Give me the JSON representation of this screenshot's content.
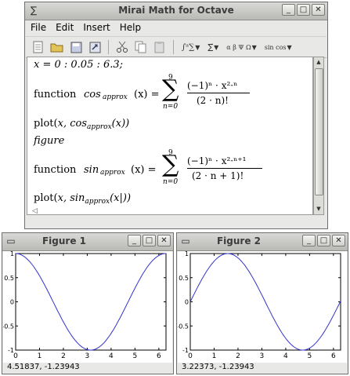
{
  "main_window": {
    "title": "Mirai Math for Octave",
    "icon": "sigma-icon",
    "menus": [
      "File",
      "Edit",
      "Insert",
      "Help"
    ],
    "menu_mnemonics": [
      "F",
      "E",
      "I",
      "H"
    ],
    "toolbar_icons": [
      "new-document-icon",
      "open-folder-icon",
      "save-icon",
      "export-icon",
      "cut-icon",
      "copy-icon",
      "paste-icon",
      "integral-sum-icon",
      "arrow-sum-icon",
      "greek-letters-icon",
      "functions-icon"
    ],
    "toolbar_math_labels": [
      "∫ᵃ∑",
      "∑⃗",
      "α β Ψ Ω",
      "sin cos"
    ],
    "lines": {
      "l1": "x = 0 : 0.05 : 6.3;",
      "l2_prefix": "function",
      "l2_fn": "cos",
      "l2_sub": "approx",
      "l2_arg": "(x) =",
      "l2_sum_top": "9",
      "l2_sum_bottom": "n=0",
      "l2_num": "(−1)ⁿ · x²·ⁿ",
      "l2_den": "(2 · n)!",
      "l3_a": "plot(",
      "l3_b": "x, cos",
      "l3_sub": "approx",
      "l3_c": "(x))",
      "l4": "figure",
      "l5_prefix": "function",
      "l5_fn": "sin",
      "l5_sub": "approx",
      "l5_arg": "(x) =",
      "l5_sum_top": "9",
      "l5_sum_bottom": "n=0",
      "l5_num": "(−1)ⁿ · x²·ⁿ⁺¹",
      "l5_den": "(2 · n + 1)!",
      "l6_a": "plot(",
      "l6_b": "x, sin",
      "l6_sub": "approx",
      "l6_c": "(x|))"
    }
  },
  "figure1": {
    "title": "Figure 1",
    "status": "4.51837, -1.23943",
    "chart_data": {
      "type": "line",
      "title": "",
      "xlim": [
        0,
        6.3
      ],
      "ylim": [
        -1,
        1
      ],
      "xticks": [
        "0",
        "1",
        "2",
        "3",
        "4",
        "5",
        "6"
      ],
      "yticks": [
        "1",
        "0.5",
        "0",
        "-0.5",
        "-1"
      ],
      "series": [
        {
          "function": "cos",
          "x_start": 0,
          "x_end": 6.3,
          "x_step": 0.05,
          "color": "#3333cc"
        }
      ]
    }
  },
  "figure2": {
    "title": "Figure 2",
    "status": "3.22373, -1.23943",
    "chart_data": {
      "type": "line",
      "title": "",
      "xlim": [
        0,
        6.3
      ],
      "ylim": [
        -1,
        1
      ],
      "xticks": [
        "0",
        "1",
        "2",
        "3",
        "4",
        "5",
        "6"
      ],
      "yticks": [
        "1",
        "0.5",
        "0",
        "-0.5",
        "-1"
      ],
      "series": [
        {
          "function": "sin",
          "x_start": 0,
          "x_end": 6.3,
          "x_step": 0.05,
          "color": "#3333cc"
        }
      ]
    }
  },
  "window_buttons": {
    "minimize": "_",
    "maximize": "□",
    "close": "✕"
  }
}
